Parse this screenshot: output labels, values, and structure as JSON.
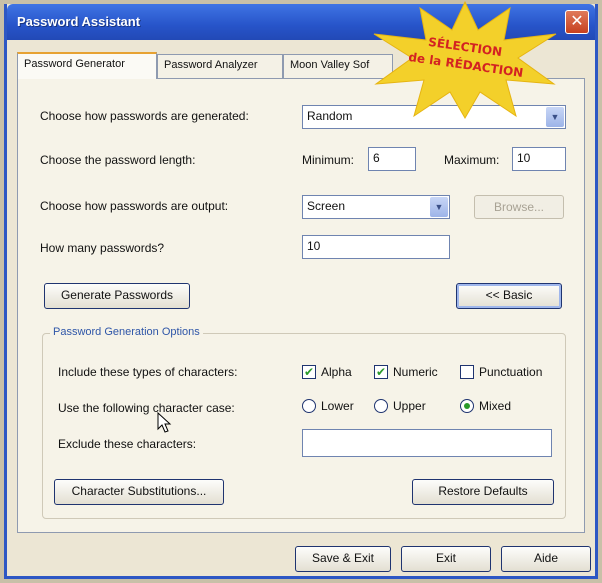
{
  "window": {
    "title": "Password Assistant",
    "close_glyph": "✕"
  },
  "tabs": [
    {
      "label": "Password Generator",
      "active": true
    },
    {
      "label": "Password Analyzer",
      "active": false
    },
    {
      "label": "Moon Valley Sof",
      "active": false
    }
  ],
  "badge": {
    "line1": "SÉLECTION",
    "line2": "de la RÉDACTION",
    "color": "#f3d02a"
  },
  "generation": {
    "method_label": "Choose how passwords are generated:",
    "method_value": "Random",
    "length_label": "Choose the password length:",
    "min_label": "Minimum:",
    "min_value": "6",
    "max_label": "Maximum:",
    "max_value": "10",
    "output_label": "Choose how passwords are output:",
    "output_value": "Screen",
    "browse_label": "Browse...",
    "count_label": "How many passwords?",
    "count_value": "10",
    "generate_label": "Generate Passwords",
    "basic_label": "<< Basic"
  },
  "options": {
    "group_title": "Password Generation Options",
    "types_label": "Include these types of characters:",
    "types": [
      {
        "label": "Alpha",
        "checked": true
      },
      {
        "label": "Numeric",
        "checked": true
      },
      {
        "label": "Punctuation",
        "checked": false
      }
    ],
    "case_label": "Use the following character case:",
    "cases": [
      {
        "label": "Lower",
        "selected": false
      },
      {
        "label": "Upper",
        "selected": false
      },
      {
        "label": "Mixed",
        "selected": true
      }
    ],
    "exclude_label": "Exclude these characters:",
    "exclude_value": "",
    "substitutions_label": "Character Substitutions...",
    "restore_label": "Restore Defaults"
  },
  "footer": {
    "save_exit_label": "Save & Exit",
    "exit_label": "Exit",
    "help_label": "Aide"
  }
}
